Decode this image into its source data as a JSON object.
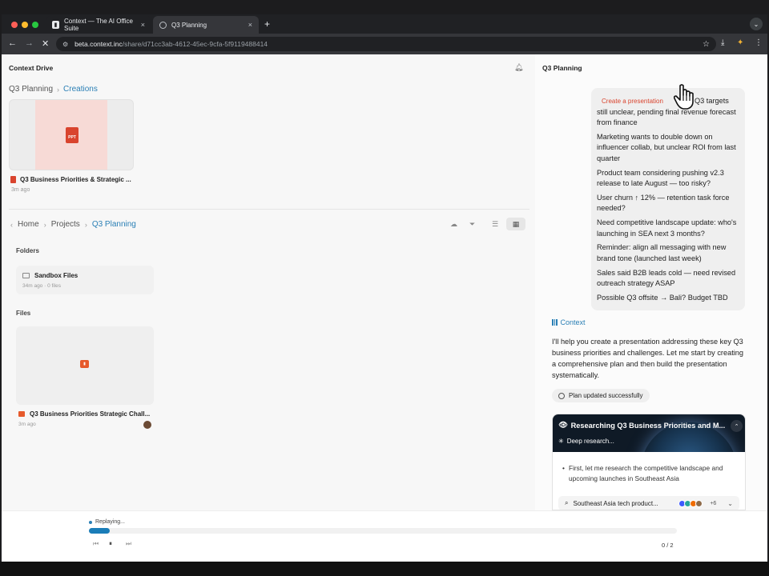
{
  "browser": {
    "tabs": [
      {
        "label": "Context — The AI Office Suite",
        "close": "×"
      },
      {
        "label": "Q3 Planning",
        "close": "×"
      }
    ],
    "new_tab": "+",
    "url_host": "beta.context.inc",
    "url_path": "/share/d71cc3ab-4612-45ec-9cfa-5f9119488414",
    "colors": {
      "red": "#ff5f57",
      "yellow": "#febc2e",
      "green": "#28c840"
    }
  },
  "drive": {
    "title": "Context Drive",
    "breadcrumb_top": {
      "parent": "Q3 Planning",
      "current": "Creations"
    },
    "recent_file": {
      "title": "Q3 Business Priorities & Strategic ...",
      "meta": "3m ago",
      "badge": "PPT"
    },
    "breadcrumb_main": {
      "home": "Home",
      "projects": "Projects",
      "current": "Q3 Planning"
    },
    "folders_label": "Folders",
    "folder": {
      "name": "Sandbox Files",
      "meta": "34m ago · 0 files"
    },
    "files_label": "Files",
    "file": {
      "title": "Q3 Business Priorities Strategic Chall...",
      "meta": "3m ago"
    }
  },
  "chat": {
    "title": "Q3 Planning",
    "user_chip": "Create a presentation",
    "user_lines": [
      "Q3 targets still unclear, pending final revenue forecast from finance",
      "Marketing wants to double down on influencer collab, but unclear ROI from last quarter",
      "Product team considering pushing v2.3 release to late August — too risky?",
      "User churn ↑ 12% — retention task force needed?",
      "Need competitive landscape update: who's launching in SEA next 3 months?",
      "Reminder: align all messaging with new brand tone (launched last week)",
      "Sales said B2B leads cold — need revised outreach strategy ASAP",
      "Possible Q3 offsite → Bali? Budget TBD"
    ],
    "assistant_name": "Context",
    "assistant_text": "I'll help you create a presentation addressing these key Q3 business priorities and challenges. Let me start by creating a comprehensive plan and then build the presentation systematically.",
    "plan_status": "Plan updated successfully",
    "research": {
      "title": "Researching Q3 Business Priorities and M...",
      "status": "Deep research...",
      "bullet": "First, let me research the competitive landscape and upcoming launches in Southeast Asia",
      "search_query": "Southeast Asia tech product...",
      "more_sources": "+6"
    }
  },
  "replay": {
    "label": "Replaying...",
    "progress": 0.035,
    "counter": "0 / 2"
  }
}
